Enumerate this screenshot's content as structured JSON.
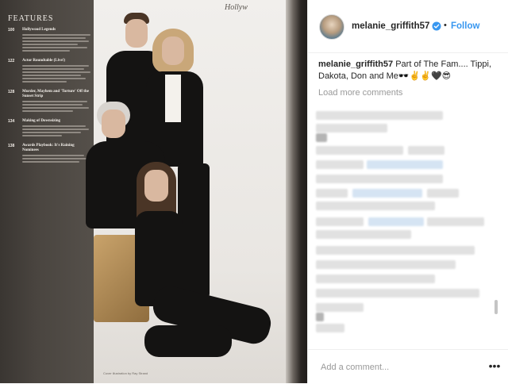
{
  "post": {
    "username": "melanie_griffith57",
    "follow_label": "Follow",
    "dot": "•",
    "caption_text": "Part of The Fam.... Tippi, Dakota, Don and Me🕶️✌️✌️🖤😎",
    "load_more_label": "Load more comments",
    "comment_placeholder": "Add a comment...",
    "more_icon": "more-options-icon",
    "verified_icon": "verified-badge-icon",
    "accent_color": "#3897f0"
  },
  "magazine": {
    "heading": "FEATURES",
    "masthead": "Hollyw",
    "credit": "Cover illustration by Ray Strand",
    "items": [
      {
        "num": "100",
        "title": "Hollywood Legends"
      },
      {
        "num": "122",
        "title": "Actor Roundtable (Live!)"
      },
      {
        "num": "128",
        "title": "Murder, Mayhem and 'Torture' Off the Sunset Strip"
      },
      {
        "num": "134",
        "title": "Making of Downsizing"
      },
      {
        "num": "138",
        "title": "Awards Playbook: It's Raining Nominees"
      }
    ]
  }
}
